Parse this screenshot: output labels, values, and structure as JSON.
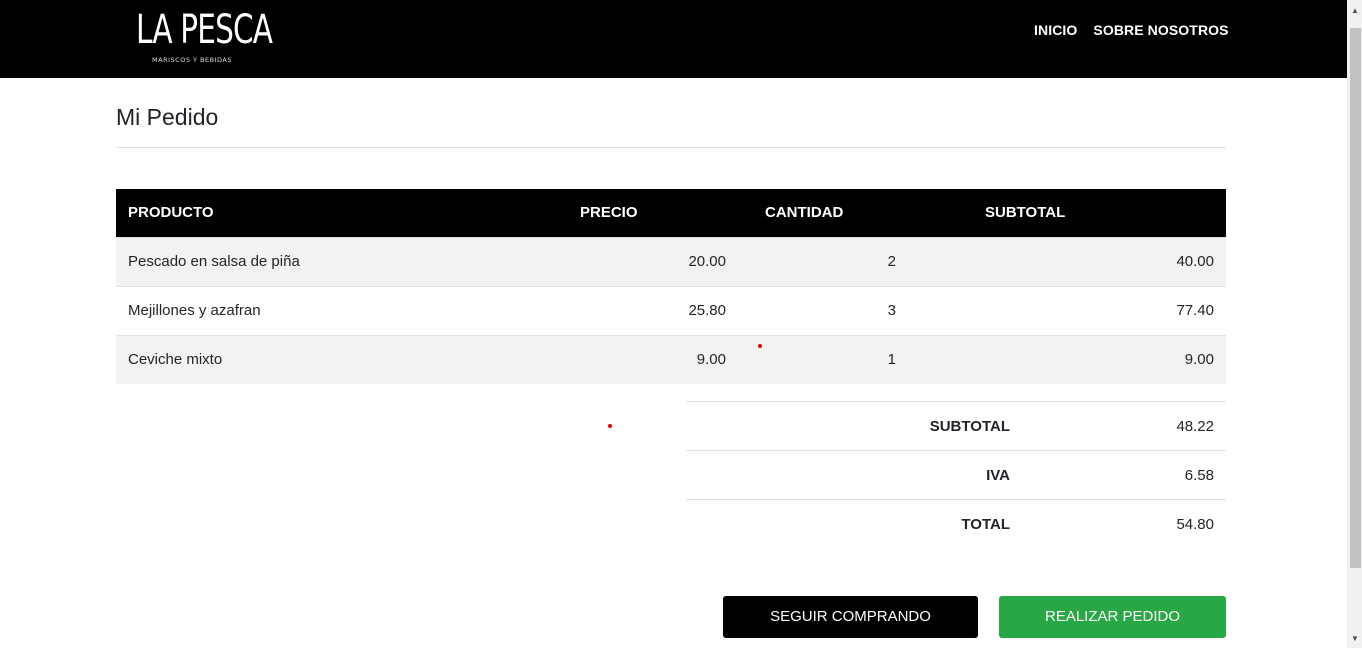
{
  "brand": {
    "name": "LA PESCA",
    "subtitle": "MARISCOS Y BEBIDAS"
  },
  "nav": {
    "items": [
      {
        "label": "INICIO"
      },
      {
        "label": "SOBRE NOSOTROS"
      }
    ]
  },
  "page": {
    "title": "Mi Pedido"
  },
  "order_table": {
    "headers": [
      "PRODUCTO",
      "PRECIO",
      "CANTIDAD",
      "SUBTOTAL"
    ],
    "rows": [
      {
        "product": "Pescado en salsa de piña",
        "price": "20.00",
        "quantity": "2",
        "subtotal": "40.00"
      },
      {
        "product": "Mejillones y azafran",
        "price": "25.80",
        "quantity": "3",
        "subtotal": "77.40"
      },
      {
        "product": "Ceviche mixto",
        "price": "9.00",
        "quantity": "1",
        "subtotal": "9.00"
      }
    ]
  },
  "totals": {
    "subtotal_label": "SUBTOTAL",
    "subtotal_value": "48.22",
    "iva_label": "IVA",
    "iva_value": "6.58",
    "total_label": "TOTAL",
    "total_value": "54.80"
  },
  "actions": {
    "continue_label": "SEGUIR COMPRANDO",
    "checkout_label": "REALIZAR PEDIDO"
  },
  "colors": {
    "header_bg": "#000000",
    "checkout_button": "#28a745",
    "continue_button": "#000000"
  }
}
